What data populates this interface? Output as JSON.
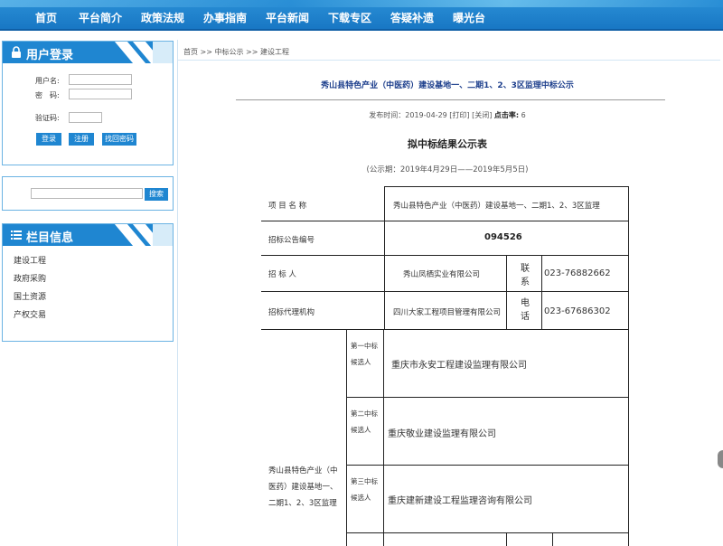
{
  "nav": {
    "items": [
      "首页",
      "平台简介",
      "政策法规",
      "办事指南",
      "平台新闻",
      "下载专区",
      "答疑补遗",
      "曝光台"
    ]
  },
  "login": {
    "title": "用户登录",
    "username_label": "用户名:",
    "password_label": "密　码:",
    "captcha_label": "验证码:",
    "login_btn": "登录",
    "register_btn": "注册",
    "forgot_btn": "找回密码"
  },
  "search": {
    "button": "搜索",
    "value": ""
  },
  "categories": {
    "title": "栏目信息",
    "items": [
      "建设工程",
      "政府采购",
      "国土资源",
      "产权交易"
    ]
  },
  "breadcrumb": "首页 >> 中标公示 >> 建设工程",
  "article": {
    "title": "秀山县特色产业（中医药）建设基地一、二期1、2、3区监理中标公示",
    "meta_prefix": "发布时间：2019-04-29  [打印] [关闭] ",
    "meta_clicks_label": "点击率:",
    "meta_clicks": "6",
    "subtitle": "拟中标结果公示表",
    "period": "(公示期：2019年4月29日——2019年5月5日)"
  },
  "table": {
    "project_name_label": "项 目 名 称",
    "project_name": "秀山县特色产业（中医药）建设基地一、二期1、2、3区监理",
    "notice_no_label": "招标公告编号",
    "notice_no": "094526",
    "tenderer_label": "招 标 人",
    "tenderer": "秀山凤栖实业有限公司",
    "contact_label": "联　系",
    "contact_phone": "023-76882662",
    "agency_label": "招标代理机构",
    "agency": "四川大家工程项目管理有限公司",
    "phone_label": "电　话",
    "agency_phone": "023-67686302",
    "section_name": "秀山县特色产业（中医药）建设基地一、二期1、2、3区监理",
    "candidates": [
      {
        "rank_label": "第一中标候选人",
        "company": "重庆市永安工程建设监理有限公司"
      },
      {
        "rank_label": "第二中标候选人",
        "company": "重庆敬业建设监理有限公司"
      },
      {
        "rank_label": "第三中标候选人",
        "company": "重庆建新建设工程监理咨询有限公司"
      }
    ]
  },
  "colors": {
    "nav_bg": "#1877c4",
    "panel_head": "#1f86d1",
    "title_blue": "#1c3e8c"
  }
}
